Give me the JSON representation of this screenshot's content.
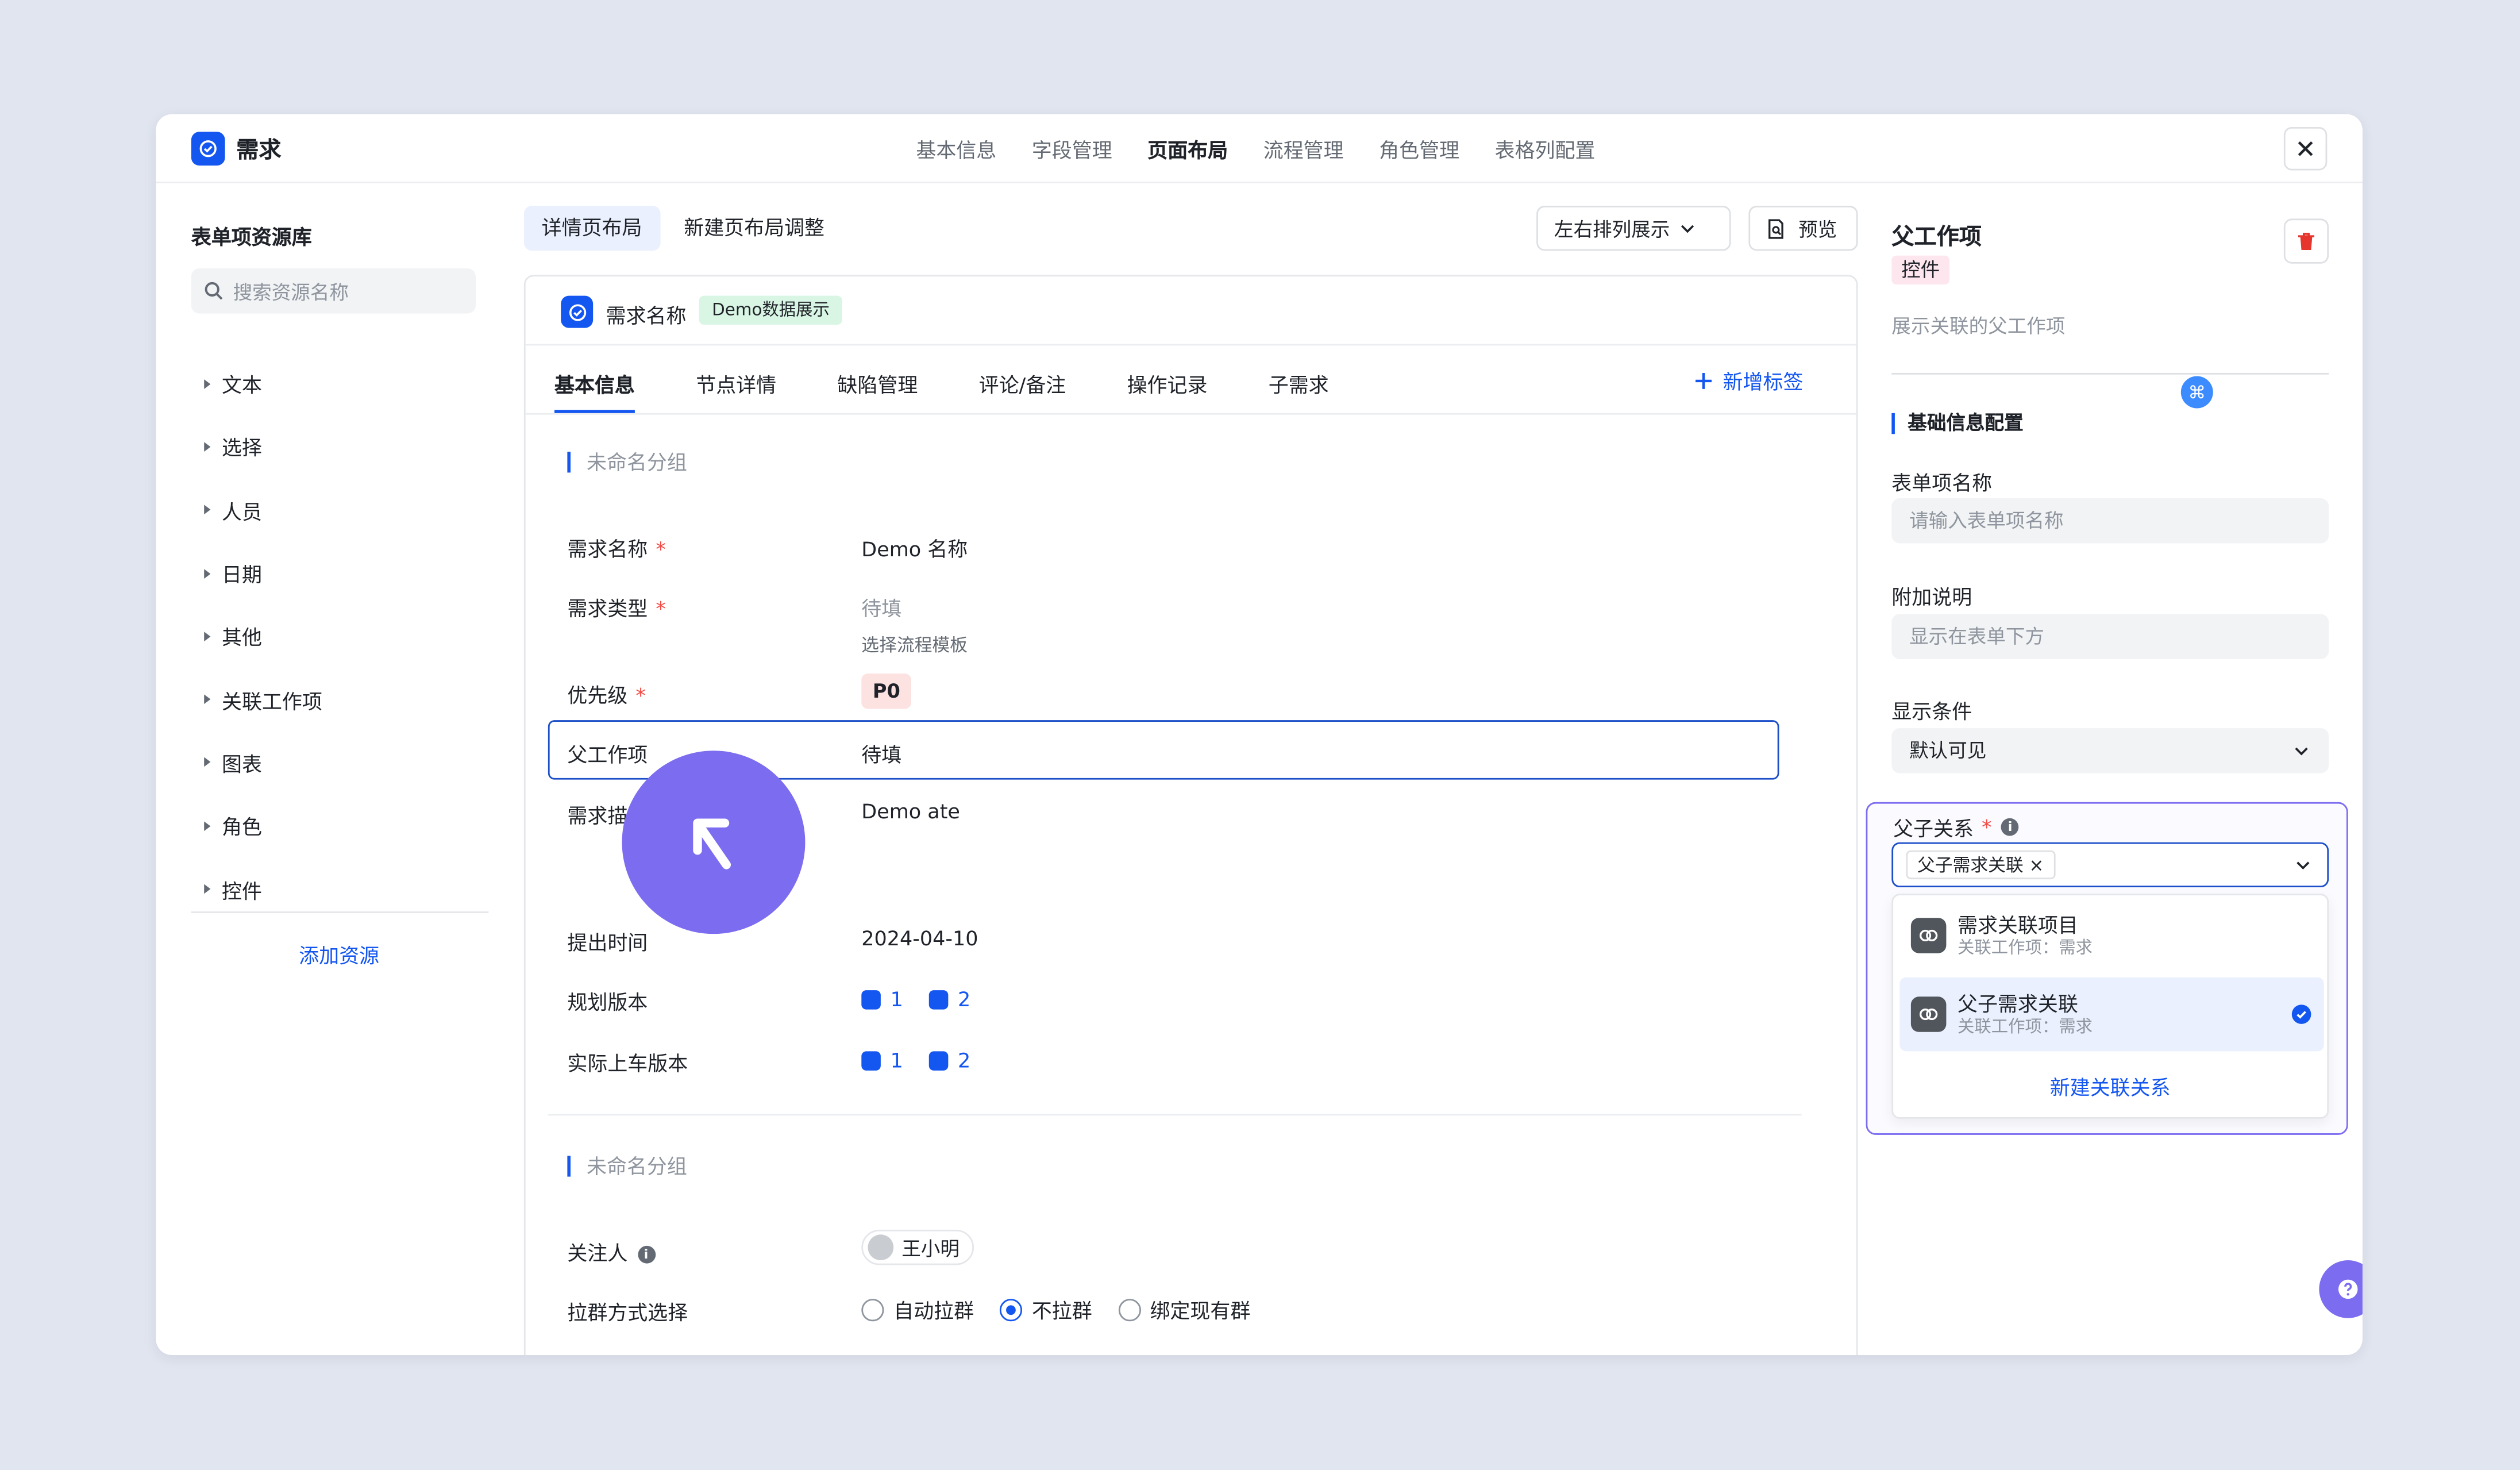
{
  "app": {
    "title": "需求"
  },
  "nav": [
    "基本信息",
    "字段管理",
    "页面布局",
    "流程管理",
    "角色管理",
    "表格列配置"
  ],
  "nav_active": 2,
  "library": {
    "title": "表单项资源库",
    "search_placeholder": "搜索资源名称",
    "items": [
      "文本",
      "选择",
      "人员",
      "日期",
      "其他",
      "关联工作项",
      "图表",
      "角色",
      "控件"
    ],
    "add_label": "添加资源"
  },
  "layout": {
    "tabs": [
      "详情页布局",
      "新建页布局调整"
    ],
    "select_value": "左右排列展示",
    "preview_label": "预览"
  },
  "card": {
    "name": "需求名称",
    "badge": "Demo数据展示",
    "tabs": [
      "基本信息",
      "节点详情",
      "缺陷管理",
      "评论/备注",
      "操作记录",
      "子需求"
    ],
    "add_tag": "新增标签",
    "group1_title": "未命名分组",
    "group2_title": "未命名分组",
    "fields": {
      "name": {
        "label": "需求名称",
        "value": "Demo 名称"
      },
      "type": {
        "label": "需求类型",
        "value": "待填",
        "sub": "选择流程模板"
      },
      "priority": {
        "label": "优先级",
        "value": "P0"
      },
      "parent": {
        "label": "父工作项",
        "value": "待填"
      },
      "desc": {
        "label": "需求描述",
        "value": "Demo ate"
      },
      "date": {
        "label": "提出时间",
        "value": "2024-04-10"
      },
      "plan_ver": {
        "label": "规划版本",
        "v1": "1",
        "v2": "2"
      },
      "real_ver": {
        "label": "实际上车版本",
        "v1": "1",
        "v2": "2"
      },
      "watcher": {
        "label": "关注人",
        "value": "王小明"
      },
      "group_chat": {
        "label": "拉群方式选择",
        "options": [
          "自动拉群",
          "不拉群",
          "绑定现有群"
        ],
        "selected": "不拉群"
      }
    }
  },
  "panel": {
    "title": "父工作项",
    "badge": "控件",
    "desc": "展示关联的父工作项",
    "section": "基础信息配置",
    "name_label": "表单项名称",
    "name_placeholder": "请输入表单项名称",
    "note_label": "附加说明",
    "note_placeholder": "显示在表单下方",
    "cond_label": "显示条件",
    "cond_value": "默认可见",
    "relation": {
      "label": "父子关系",
      "selected_tag": "父子需求关联",
      "options": [
        {
          "name": "需求关联项目",
          "sub": "关联工作项：需求"
        },
        {
          "name": "父子需求关联",
          "sub": "关联工作项：需求"
        }
      ],
      "new_label": "新建关联关系"
    }
  },
  "colors": {
    "accent": "#1456f0",
    "cursor": "#7c6cf0",
    "required": "#f54a45"
  }
}
